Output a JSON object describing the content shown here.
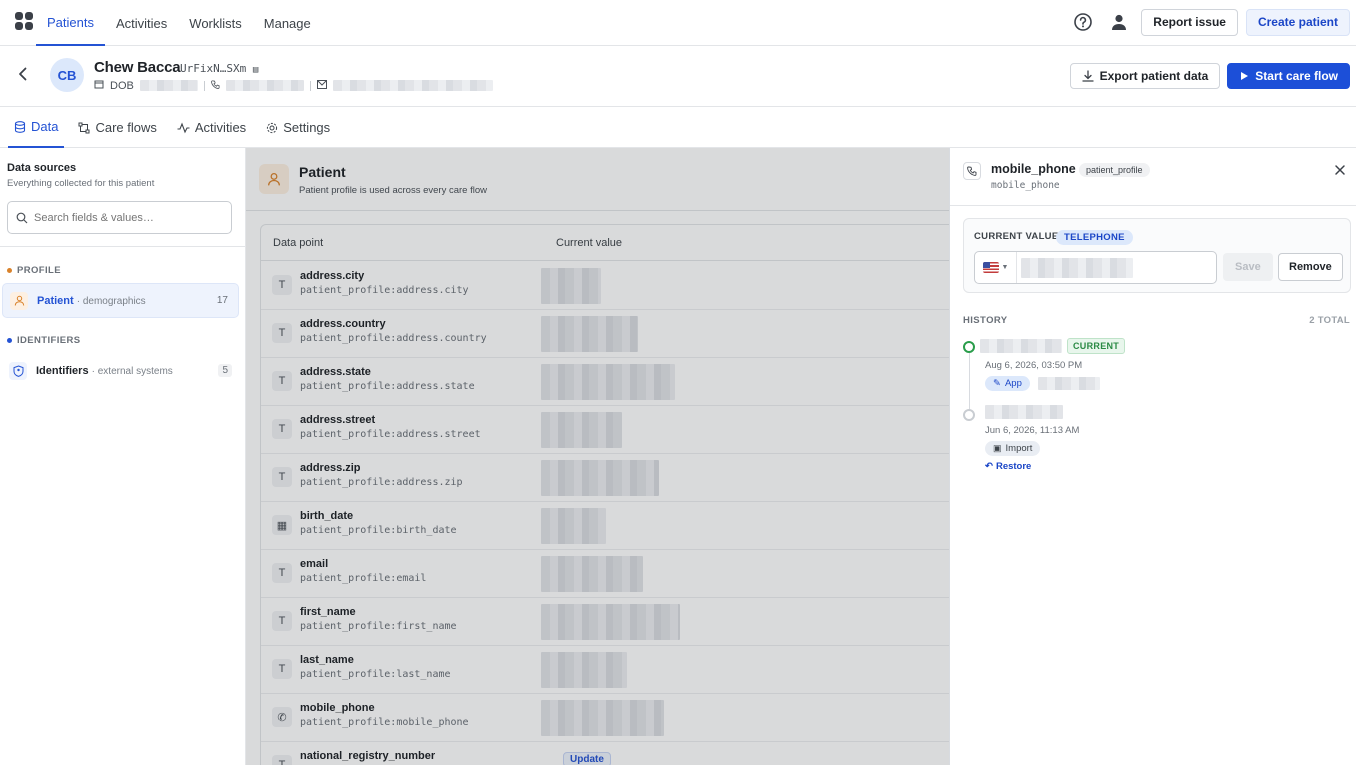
{
  "nav": {
    "tabs": [
      "Patients",
      "Activities",
      "Worklists",
      "Manage"
    ],
    "active_tab": "Patients",
    "report_issue": "Report issue",
    "create_patient": "Create patient"
  },
  "patient": {
    "initials": "CB",
    "name": "Chew Bacca",
    "id_short": "UrFixN…SXm",
    "dob_label": "DOB",
    "export_label": "Export patient data",
    "start_flow_label": "Start care flow"
  },
  "subtabs": [
    "Data",
    "Care flows",
    "Activities",
    "Settings"
  ],
  "sidebar": {
    "title": "Data sources",
    "subtitle": "Everything collected for this patient",
    "search_placeholder": "Search fields & values…",
    "sections": [
      {
        "label": "PROFILE",
        "color": "#d9822b",
        "item": {
          "name": "Patient",
          "desc": "· demographics",
          "count": "17"
        }
      },
      {
        "label": "IDENTIFIERS",
        "color": "#2453d4",
        "item": {
          "name": "Identifiers",
          "desc": "· external systems",
          "count": "5"
        }
      }
    ]
  },
  "main": {
    "title": "Patient",
    "subtitle": "Patient profile is used across every care flow",
    "columns": [
      "Data point",
      "Current value"
    ],
    "rows": [
      {
        "type": "T",
        "name": "address.city",
        "key": "patient_profile:address.city"
      },
      {
        "type": "T",
        "name": "address.country",
        "key": "patient_profile:address.country"
      },
      {
        "type": "T",
        "name": "address.state",
        "key": "patient_profile:address.state"
      },
      {
        "type": "T",
        "name": "address.street",
        "key": "patient_profile:address.street"
      },
      {
        "type": "T",
        "name": "address.zip",
        "key": "patient_profile:address.zip"
      },
      {
        "type": "calendar",
        "name": "birth_date",
        "key": "patient_profile:birth_date"
      },
      {
        "type": "T",
        "name": "email",
        "key": "patient_profile:email"
      },
      {
        "type": "T",
        "name": "first_name",
        "key": "patient_profile:first_name"
      },
      {
        "type": "T",
        "name": "last_name",
        "key": "patient_profile:last_name"
      },
      {
        "type": "phone",
        "name": "mobile_phone",
        "key": "patient_profile:mobile_phone"
      },
      {
        "type": "T",
        "name": "national_registry_number",
        "key": "",
        "action": "Update"
      }
    ]
  },
  "panel": {
    "title": "mobile_phone",
    "tag": "patient_profile",
    "key": "mobile_phone",
    "current_value_label": "CURRENT VALUE",
    "type_tag": "TELEPHONE",
    "save_label": "Save",
    "remove_label": "Remove",
    "history_label": "HISTORY",
    "history_total": "2 TOTAL",
    "history": [
      {
        "badge": "CURRENT",
        "date": "Aug 6, 2026, 03:50 PM",
        "source": "App"
      },
      {
        "date": "Jun 6, 2026, 11:13 AM",
        "source": "Import",
        "restore": "Restore"
      }
    ]
  }
}
